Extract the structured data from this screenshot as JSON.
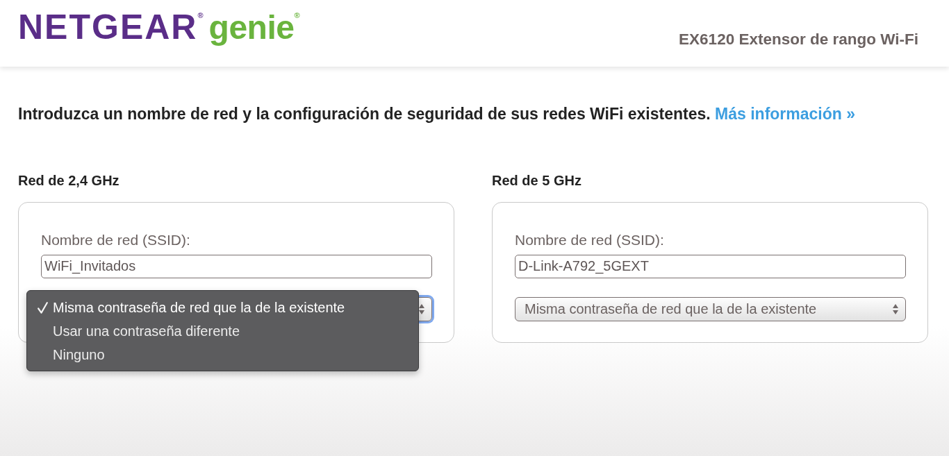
{
  "header": {
    "logo": {
      "brand": "NETGEAR$^{®}$",
      "product": "genie$^{®}$"
    },
    "title": "EX6120 Extensor de rango Wi-Fi"
  },
  "intro": {
    "text": "Introduzca un nombre de red y la configuración de seguridad de sus redes WiFi existentes.",
    "link": "Más información »"
  },
  "networks": [
    {
      "heading": "Red de 2,4 GHz",
      "ssid_label": "Nombre de red (SSID):",
      "ssid": "WiFi_Invitados",
      "security": {
        "expanded": true,
        "focused": true,
        "options": [
          {
            "label": "Misma contraseña de red que la de la existente",
            "selected": true
          },
          {
            "label": "Usar una contraseña diferente",
            "selected": false
          },
          {
            "label": "Ninguno",
            "selected": false
          }
        ]
      }
    },
    {
      "heading": "Red de 5 GHz",
      "ssid_label": "Nombre de red (SSID):",
      "ssid": "D-Link-A792_5GEXT",
      "security": {
        "value": "Misma contraseña de red que la de la existente",
        "expanded": false,
        "focused": false
      }
    }
  ]
}
